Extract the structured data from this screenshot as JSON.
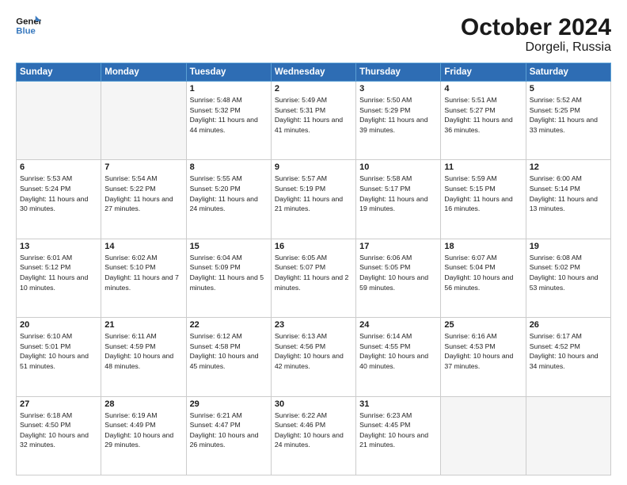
{
  "header": {
    "logo_line1": "General",
    "logo_line2": "Blue",
    "title": "October 2024",
    "subtitle": "Dorgeli, Russia"
  },
  "weekdays": [
    "Sunday",
    "Monday",
    "Tuesday",
    "Wednesday",
    "Thursday",
    "Friday",
    "Saturday"
  ],
  "weeks": [
    [
      {
        "day": "",
        "info": ""
      },
      {
        "day": "",
        "info": ""
      },
      {
        "day": "1",
        "info": "Sunrise: 5:48 AM\nSunset: 5:32 PM\nDaylight: 11 hours and 44 minutes."
      },
      {
        "day": "2",
        "info": "Sunrise: 5:49 AM\nSunset: 5:31 PM\nDaylight: 11 hours and 41 minutes."
      },
      {
        "day": "3",
        "info": "Sunrise: 5:50 AM\nSunset: 5:29 PM\nDaylight: 11 hours and 39 minutes."
      },
      {
        "day": "4",
        "info": "Sunrise: 5:51 AM\nSunset: 5:27 PM\nDaylight: 11 hours and 36 minutes."
      },
      {
        "day": "5",
        "info": "Sunrise: 5:52 AM\nSunset: 5:25 PM\nDaylight: 11 hours and 33 minutes."
      }
    ],
    [
      {
        "day": "6",
        "info": "Sunrise: 5:53 AM\nSunset: 5:24 PM\nDaylight: 11 hours and 30 minutes."
      },
      {
        "day": "7",
        "info": "Sunrise: 5:54 AM\nSunset: 5:22 PM\nDaylight: 11 hours and 27 minutes."
      },
      {
        "day": "8",
        "info": "Sunrise: 5:55 AM\nSunset: 5:20 PM\nDaylight: 11 hours and 24 minutes."
      },
      {
        "day": "9",
        "info": "Sunrise: 5:57 AM\nSunset: 5:19 PM\nDaylight: 11 hours and 21 minutes."
      },
      {
        "day": "10",
        "info": "Sunrise: 5:58 AM\nSunset: 5:17 PM\nDaylight: 11 hours and 19 minutes."
      },
      {
        "day": "11",
        "info": "Sunrise: 5:59 AM\nSunset: 5:15 PM\nDaylight: 11 hours and 16 minutes."
      },
      {
        "day": "12",
        "info": "Sunrise: 6:00 AM\nSunset: 5:14 PM\nDaylight: 11 hours and 13 minutes."
      }
    ],
    [
      {
        "day": "13",
        "info": "Sunrise: 6:01 AM\nSunset: 5:12 PM\nDaylight: 11 hours and 10 minutes."
      },
      {
        "day": "14",
        "info": "Sunrise: 6:02 AM\nSunset: 5:10 PM\nDaylight: 11 hours and 7 minutes."
      },
      {
        "day": "15",
        "info": "Sunrise: 6:04 AM\nSunset: 5:09 PM\nDaylight: 11 hours and 5 minutes."
      },
      {
        "day": "16",
        "info": "Sunrise: 6:05 AM\nSunset: 5:07 PM\nDaylight: 11 hours and 2 minutes."
      },
      {
        "day": "17",
        "info": "Sunrise: 6:06 AM\nSunset: 5:05 PM\nDaylight: 10 hours and 59 minutes."
      },
      {
        "day": "18",
        "info": "Sunrise: 6:07 AM\nSunset: 5:04 PM\nDaylight: 10 hours and 56 minutes."
      },
      {
        "day": "19",
        "info": "Sunrise: 6:08 AM\nSunset: 5:02 PM\nDaylight: 10 hours and 53 minutes."
      }
    ],
    [
      {
        "day": "20",
        "info": "Sunrise: 6:10 AM\nSunset: 5:01 PM\nDaylight: 10 hours and 51 minutes."
      },
      {
        "day": "21",
        "info": "Sunrise: 6:11 AM\nSunset: 4:59 PM\nDaylight: 10 hours and 48 minutes."
      },
      {
        "day": "22",
        "info": "Sunrise: 6:12 AM\nSunset: 4:58 PM\nDaylight: 10 hours and 45 minutes."
      },
      {
        "day": "23",
        "info": "Sunrise: 6:13 AM\nSunset: 4:56 PM\nDaylight: 10 hours and 42 minutes."
      },
      {
        "day": "24",
        "info": "Sunrise: 6:14 AM\nSunset: 4:55 PM\nDaylight: 10 hours and 40 minutes."
      },
      {
        "day": "25",
        "info": "Sunrise: 6:16 AM\nSunset: 4:53 PM\nDaylight: 10 hours and 37 minutes."
      },
      {
        "day": "26",
        "info": "Sunrise: 6:17 AM\nSunset: 4:52 PM\nDaylight: 10 hours and 34 minutes."
      }
    ],
    [
      {
        "day": "27",
        "info": "Sunrise: 6:18 AM\nSunset: 4:50 PM\nDaylight: 10 hours and 32 minutes."
      },
      {
        "day": "28",
        "info": "Sunrise: 6:19 AM\nSunset: 4:49 PM\nDaylight: 10 hours and 29 minutes."
      },
      {
        "day": "29",
        "info": "Sunrise: 6:21 AM\nSunset: 4:47 PM\nDaylight: 10 hours and 26 minutes."
      },
      {
        "day": "30",
        "info": "Sunrise: 6:22 AM\nSunset: 4:46 PM\nDaylight: 10 hours and 24 minutes."
      },
      {
        "day": "31",
        "info": "Sunrise: 6:23 AM\nSunset: 4:45 PM\nDaylight: 10 hours and 21 minutes."
      },
      {
        "day": "",
        "info": ""
      },
      {
        "day": "",
        "info": ""
      }
    ]
  ]
}
